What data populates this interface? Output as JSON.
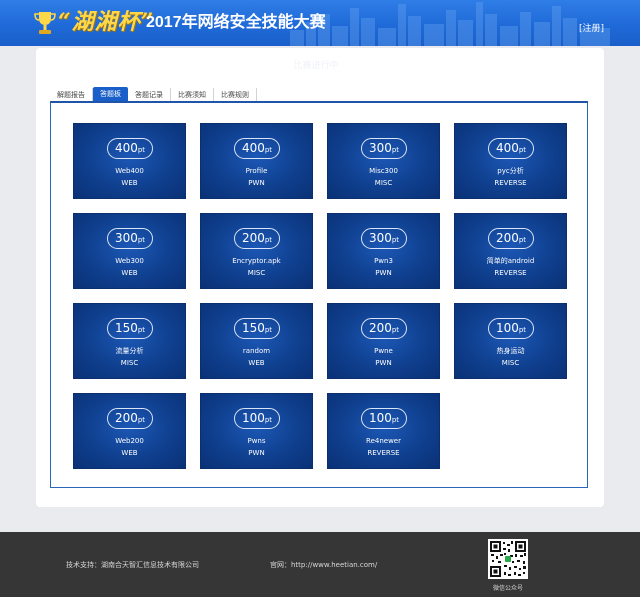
{
  "header": {
    "brand_quote": "“湖湘杯”",
    "title": "2017年网络安全技能大赛",
    "register_label": "[注册]",
    "trophy_icon": "trophy-icon"
  },
  "panel": {
    "subtitle": "比赛进行中"
  },
  "tabs": [
    {
      "label": "解题报告",
      "active": false
    },
    {
      "label": "答题板",
      "active": true
    },
    {
      "label": "答题记录",
      "active": false
    },
    {
      "label": "比赛须知",
      "active": false
    },
    {
      "label": "比赛规则",
      "active": false
    }
  ],
  "challenges": [
    {
      "points": "400",
      "unit": "pt",
      "name": "Web400",
      "category": "WEB"
    },
    {
      "points": "400",
      "unit": "pt",
      "name": "Profile",
      "category": "PWN"
    },
    {
      "points": "300",
      "unit": "pt",
      "name": "Misc300",
      "category": "MISC"
    },
    {
      "points": "400",
      "unit": "pt",
      "name": "pyc分析",
      "category": "REVERSE"
    },
    {
      "points": "300",
      "unit": "pt",
      "name": "Web300",
      "category": "WEB"
    },
    {
      "points": "200",
      "unit": "pt",
      "name": "Encryptor.apk",
      "category": "MISC"
    },
    {
      "points": "300",
      "unit": "pt",
      "name": "Pwn3",
      "category": "PWN"
    },
    {
      "points": "200",
      "unit": "pt",
      "name": "简单的android",
      "category": "REVERSE"
    },
    {
      "points": "150",
      "unit": "pt",
      "name": "流量分析",
      "category": "MISC"
    },
    {
      "points": "150",
      "unit": "pt",
      "name": "random",
      "category": "WEB"
    },
    {
      "points": "200",
      "unit": "pt",
      "name": "Pwne",
      "category": "PWN"
    },
    {
      "points": "100",
      "unit": "pt",
      "name": "热身运动",
      "category": "MISC"
    },
    {
      "points": "200",
      "unit": "pt",
      "name": "Web200",
      "category": "WEB"
    },
    {
      "points": "100",
      "unit": "pt",
      "name": "Pwns",
      "category": "PWN"
    },
    {
      "points": "100",
      "unit": "pt",
      "name": "Re4newer",
      "category": "REVERSE"
    }
  ],
  "footer": {
    "support": "技术支持：湖南合天智汇信息技术有限公司",
    "site": "官网：http://www.heetian.com/",
    "qr_caption": "微信公众号"
  }
}
